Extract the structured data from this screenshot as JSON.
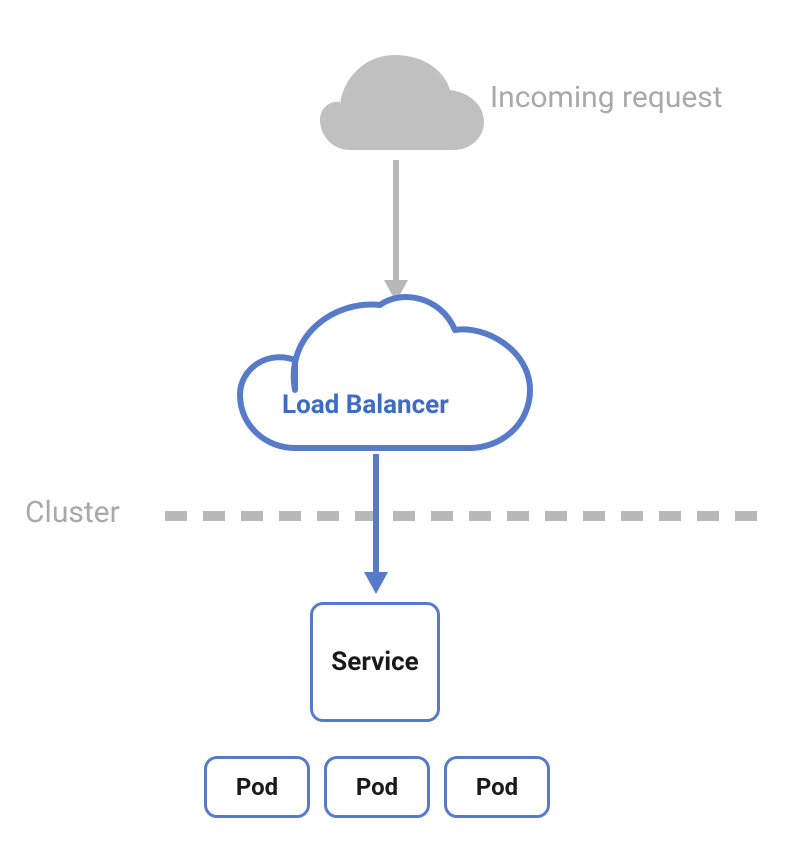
{
  "labels": {
    "incoming": "Incoming request",
    "cluster": "Cluster",
    "load_balancer": "Load Balancer",
    "service": "Service",
    "pods": [
      "Pod",
      "Pod",
      "Pod"
    ]
  },
  "colors": {
    "gray_fill": "#c0c0c0",
    "gray_stroke": "#b8b8b8",
    "blue_stroke": "#587bc9",
    "blue_text": "#3d6bc7",
    "gray_text": "#a9a9a9"
  },
  "diagram": {
    "type": "architecture",
    "flow": [
      "incoming-cloud",
      "load-balancer",
      "service",
      "pods"
    ],
    "boundary": "cluster-line between load-balancer and service"
  }
}
